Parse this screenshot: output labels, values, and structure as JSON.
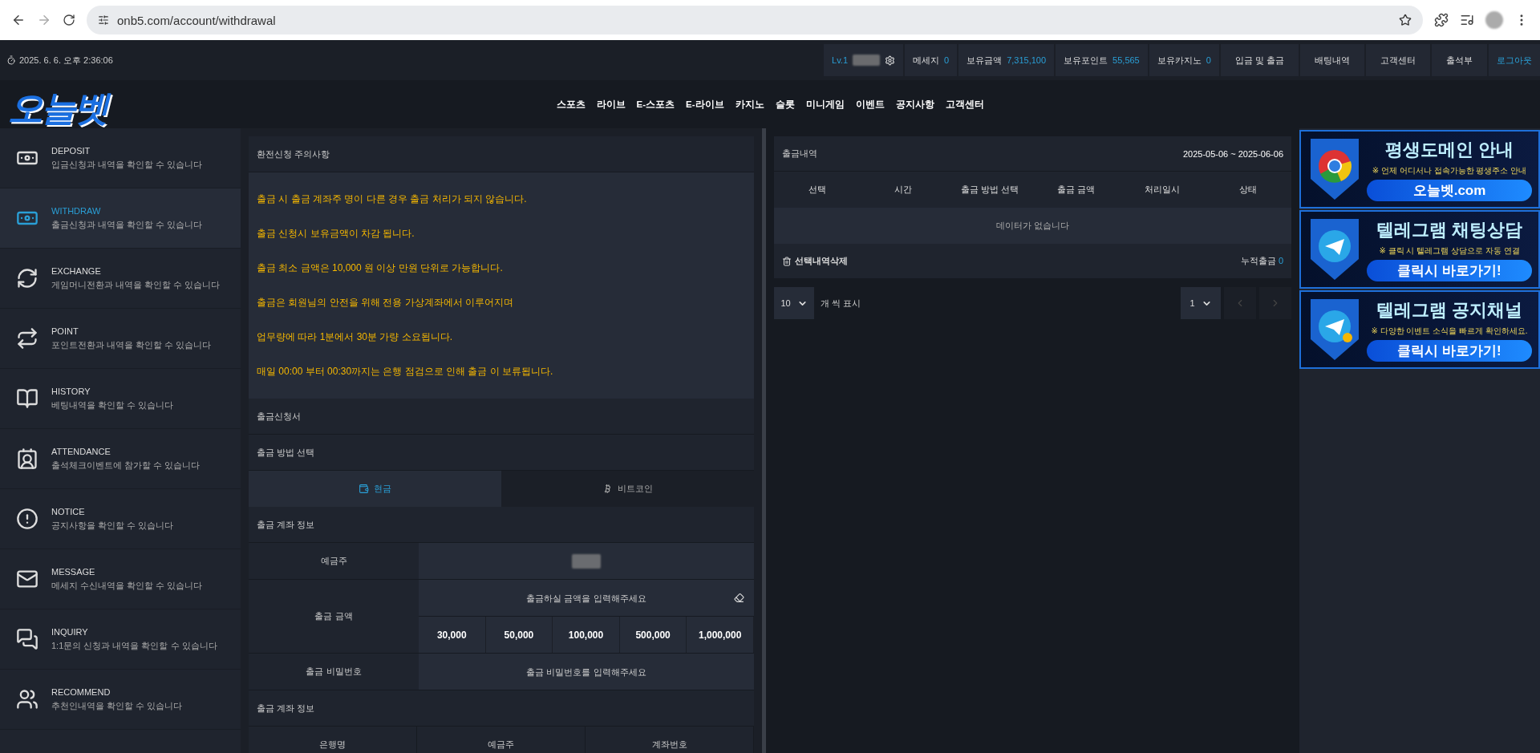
{
  "browser": {
    "url": "onb5.com/account/withdrawal"
  },
  "topbar": {
    "datetime": "2025. 6. 6. 오후 2:36:06",
    "level": "Lv.1",
    "stats": [
      {
        "label": "메세지",
        "value": "0"
      },
      {
        "label": "보유금액",
        "value": "7,315,100"
      },
      {
        "label": "보유포인트",
        "value": "55,565"
      },
      {
        "label": "보유카지노",
        "value": "0"
      }
    ],
    "links": [
      "입금 및 출금",
      "배팅내역",
      "고객센터",
      "출석부"
    ],
    "logout": "로그아웃"
  },
  "nav": {
    "logo": "오늘벳",
    "items": [
      "스포츠",
      "라이브",
      "E-스포츠",
      "E-라이브",
      "카지노",
      "슬롯",
      "미니게임",
      "이벤트",
      "공지사항",
      "고객센터"
    ]
  },
  "sidebar": [
    {
      "title": "DEPOSIT",
      "desc": "입금신청과 내역을 확인할 수 있습니다",
      "selected": false
    },
    {
      "title": "WITHDRAW",
      "desc": "출금신청과 내역을 확인할 수 있습니다",
      "selected": true
    },
    {
      "title": "EXCHANGE",
      "desc": "게임머니전환과 내역을 확인할 수 있습니다",
      "selected": false
    },
    {
      "title": "POINT",
      "desc": "포인트전환과 내역을 확인할 수 있습니다",
      "selected": false
    },
    {
      "title": "HISTORY",
      "desc": "베팅내역을 확인할 수 있습니다",
      "selected": false
    },
    {
      "title": "ATTENDANCE",
      "desc": "출석체크이벤트에 참가할 수 있습니다",
      "selected": false
    },
    {
      "title": "NOTICE",
      "desc": "공지사항을 확인할 수 있습니다",
      "selected": false
    },
    {
      "title": "MESSAGE",
      "desc": "메세지 수신내역을 확인할 수 있습니다",
      "selected": false
    },
    {
      "title": "INQUIRY",
      "desc": "1:1문의 신청과 내역을 확인할 수 있습니다",
      "selected": false
    },
    {
      "title": "RECOMMEND",
      "desc": "추천인내역을 확인할 수 있습니다",
      "selected": false
    }
  ],
  "notice": {
    "title": "환전신청 주의사항",
    "lines": [
      "출금 시 출금 계좌주 명이 다른 경우 출금 처리가 되지 않습니다.",
      "출금 신청시 보유금액이 차감 됩니다.",
      "출금 최소 금액은 10,000 원 이상 만원 단위로 가능합니다.",
      "출금은 회원님의 안전을 위해 전용 가상계좌에서 이루어지며",
      "업무량에 따라 1분에서 30분 가량 소요됩니다.",
      "매일 00:00 부터 00:30까지는 은행 점검으로 인해 출금 이 보류됩니다."
    ]
  },
  "form": {
    "title": "출금신청서",
    "method_title": "출금 방법 선택",
    "methods": [
      {
        "label": "현금",
        "kind": "cash",
        "selected": true
      },
      {
        "label": "비트코인",
        "kind": "bitcoin",
        "selected": false
      }
    ],
    "account_title": "출금 계좌 정보",
    "holder_label": "예금주",
    "amount_label": "출금 금액",
    "amount_placeholder": "출금하실 금액을 입력해주세요",
    "quick_amounts": [
      "30,000",
      "50,000",
      "100,000",
      "500,000",
      "1,000,000"
    ],
    "password_label": "출금 비밀번호",
    "password_placeholder": "출금 비밀번호를 입력해주세요",
    "bank_title": "출금 계좌 정보",
    "bank_columns": [
      "은행명",
      "예금주",
      "계좌번호"
    ]
  },
  "history": {
    "title": "출금내역",
    "range": "2025-05-06 ~ 2025-06-06",
    "columns": [
      "선택",
      "시간",
      "출금 방법 선택",
      "출금 금액",
      "처리일시",
      "상태"
    ],
    "empty": "데이터가 없습니다",
    "delete_label": "선택내역삭제",
    "total_label": "누적출금",
    "total_value": "0",
    "page_size": "10",
    "page_size_label": "개 씩 표시",
    "page": "1"
  },
  "banners": [
    {
      "kind": "chrome",
      "title": "평생도메인 안내",
      "subtitle": "※ 언제 어디서나 접속가능한 평생주소 안내",
      "button": "오늘벳.com"
    },
    {
      "kind": "telegram",
      "title": "텔레그램 채팅상담",
      "subtitle": "※ 클릭 시 텔레그램 상담으로 자동 연결",
      "button": "클릭시 바로가기!"
    },
    {
      "kind": "telegram-bell",
      "title": "텔레그램 공지채널",
      "subtitle": "※ 다양한 이벤트 소식을 빠르게 확인하세요.",
      "button": "클릭시 바로가기!"
    }
  ]
}
